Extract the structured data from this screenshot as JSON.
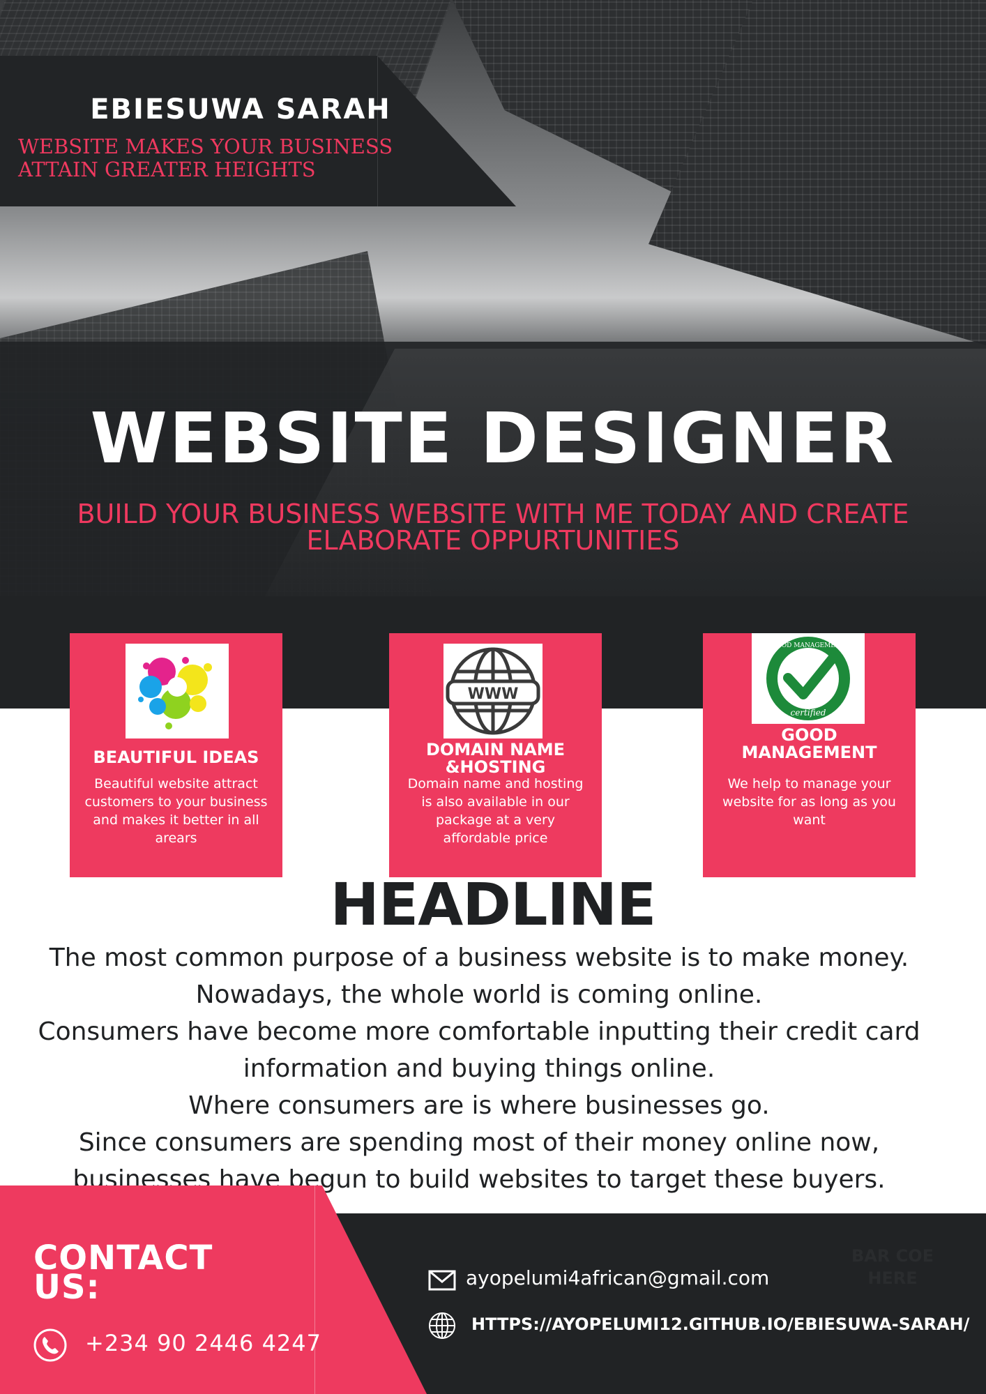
{
  "brand": {
    "name": "EBIESUWA SARAH",
    "tagline_line1": "WEBSITE MAKES YOUR BUSINESS",
    "tagline_line2": "ATTAIN GREATER HEIGHTS"
  },
  "hero": {
    "title": "WEBSITE DESIGNER",
    "subtitle_line1": "BUILD YOUR BUSINESS WEBSITE WITH ME TODAY AND CREATE",
    "subtitle_line2": "ELABORATE OPPURTUNITIES"
  },
  "features": [
    {
      "title": "BEAUTIFUL IDEAS",
      "icon": "paint-splash-icon",
      "description": "Beautiful website attract customers to your business and makes it better in all arears"
    },
    {
      "title_line1": "DOMAIN NAME",
      "title_line2": "&HOSTING",
      "icon": "www-globe-icon",
      "icon_label": "WWW",
      "description": "Domain name and hosting is also available in our package at a very affordable price"
    },
    {
      "title_line1": "GOOD",
      "title_line2": "MANAGEMENT",
      "icon": "good-management-certified-badge",
      "badge_text_top": "GOOD MANAGEMENT",
      "badge_text_bottom": "certified",
      "description": "We help to manage your website for as long as you want"
    }
  ],
  "headline": "HEADLINE",
  "body_lines": [
    "The most common purpose of a business website is to make money.",
    "Nowadays, the whole world is coming online.",
    "Consumers have become more comfortable inputting their credit card",
    "information and buying things online.",
    "Where consumers are is where businesses go.",
    "Since consumers are spending most of their money online now,",
    "businesses have begun to build websites to target these buyers."
  ],
  "contact": {
    "heading_line1": "CONTACT",
    "heading_line2": "US:",
    "phone": "+234 90 2446 4247",
    "email": "ayopelumi4african@gmail.com",
    "url": "HTTPS://AYOPELUMI12.GITHUB.IO/EBIESUWA-SARAH/",
    "barcode_line1": "BAR COE",
    "barcode_line2": "HERE"
  },
  "colors": {
    "accent_pink": "#ee3a5f",
    "dark": "#212325",
    "white": "#ffffff"
  }
}
